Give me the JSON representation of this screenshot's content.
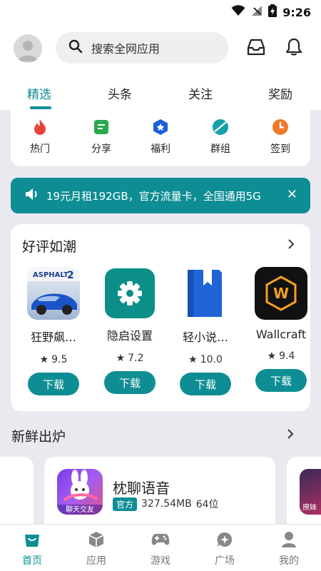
{
  "status": {
    "time": "9:26"
  },
  "search": {
    "placeholder": "搜索全网应用"
  },
  "tabs": [
    {
      "label": "精选",
      "active": true
    },
    {
      "label": "头条",
      "active": false
    },
    {
      "label": "关注",
      "active": false
    },
    {
      "label": "奖励",
      "active": false
    }
  ],
  "categories": [
    {
      "label": "热门",
      "icon": "fire-icon",
      "color": "#e8423a"
    },
    {
      "label": "分享",
      "icon": "share-icon",
      "color": "#2aa84a"
    },
    {
      "label": "福利",
      "icon": "gift-icon",
      "color": "#1c5fd8"
    },
    {
      "label": "群组",
      "icon": "group-icon",
      "color": "#14a0a8"
    },
    {
      "label": "签到",
      "icon": "clock-icon",
      "color": "#f07a2a"
    }
  ],
  "notice": {
    "text": "19元月租192GB，官方流量卡，全国通用5G",
    "icon": "speaker-icon"
  },
  "good_section": {
    "title": "好评如潮",
    "apps": [
      {
        "name": "狂野飙…",
        "rating": "9.5",
        "download": "下载"
      },
      {
        "name": "隐启设置",
        "rating": "7.2",
        "download": "下载"
      },
      {
        "name": "轻小说…",
        "rating": "10.0",
        "download": "下载"
      },
      {
        "name": "Wallcraft",
        "rating": "9.4",
        "download": "下载"
      }
    ]
  },
  "fresh_section": {
    "title": "新鲜出炉",
    "app": {
      "name": "枕聊语音",
      "badge": "官方",
      "size": "327.54MB",
      "arch": "64位",
      "icon_text": "聊天交友"
    },
    "peek_text": "撩妹"
  },
  "bottom_nav": [
    {
      "label": "首页",
      "icon": "home-bag-icon",
      "active": true
    },
    {
      "label": "应用",
      "icon": "box-icon",
      "active": false
    },
    {
      "label": "游戏",
      "icon": "gamepad-icon",
      "active": false
    },
    {
      "label": "广场",
      "icon": "chat-star-icon",
      "active": false
    },
    {
      "label": "我的",
      "icon": "person-icon",
      "active": false
    }
  ],
  "colors": {
    "accent": "#0e8e94",
    "background": "#e9e9f0"
  }
}
